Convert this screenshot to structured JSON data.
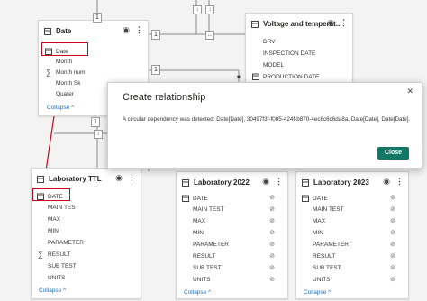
{
  "tables": {
    "date": {
      "title": "Date",
      "fields": [
        {
          "label": "Date",
          "icon": "calendar-icon"
        },
        {
          "label": "Month",
          "icon": "none"
        },
        {
          "label": "Month num",
          "icon": "sigma-icon"
        },
        {
          "label": "Month Sk",
          "icon": "none"
        },
        {
          "label": "Quater",
          "icon": "none"
        }
      ],
      "collapse": "Collapse"
    },
    "voltage": {
      "title": "Voltage and temperat...",
      "fields": [
        "DRV",
        "INSPECTION DATE",
        "MODEL",
        "PRODUCTION DATE"
      ]
    },
    "lab_ttl": {
      "title": "Laboratory TTL",
      "fields": [
        "DATE",
        "MAIN TEST",
        "MAX",
        "MIN",
        "PARAMETER",
        "RESULT",
        "SUB TEST",
        "UNITS"
      ],
      "collapse": "Collapse"
    },
    "lab_2022": {
      "title": "Laboratory 2022",
      "fields": [
        "DATE",
        "MAIN TEST",
        "MAX",
        "MIN",
        "PARAMETER",
        "RESULT",
        "SUB TEST",
        "UNITS"
      ],
      "collapse": "Collapse"
    },
    "lab_2023": {
      "title": "Laboratory 2023",
      "fields": [
        "DATE",
        "MAIN TEST",
        "MAX",
        "MIN",
        "PARAMETER",
        "RESULT",
        "SUB TEST",
        "UNITS"
      ],
      "collapse": "Collapse"
    }
  },
  "connectors": {
    "one": "1",
    "many": "*"
  },
  "dialog": {
    "title": "Create relationship",
    "message": "A circular dependency was detected: Date[Date], 30497f3f-f085-424f-b870-4ec8c6c6da8a, Date[Date], Date[Date].",
    "close_button": "Close"
  },
  "colors": {
    "accent": "#117865",
    "highlight": "#d0021b",
    "link": "#1b6ec2"
  }
}
